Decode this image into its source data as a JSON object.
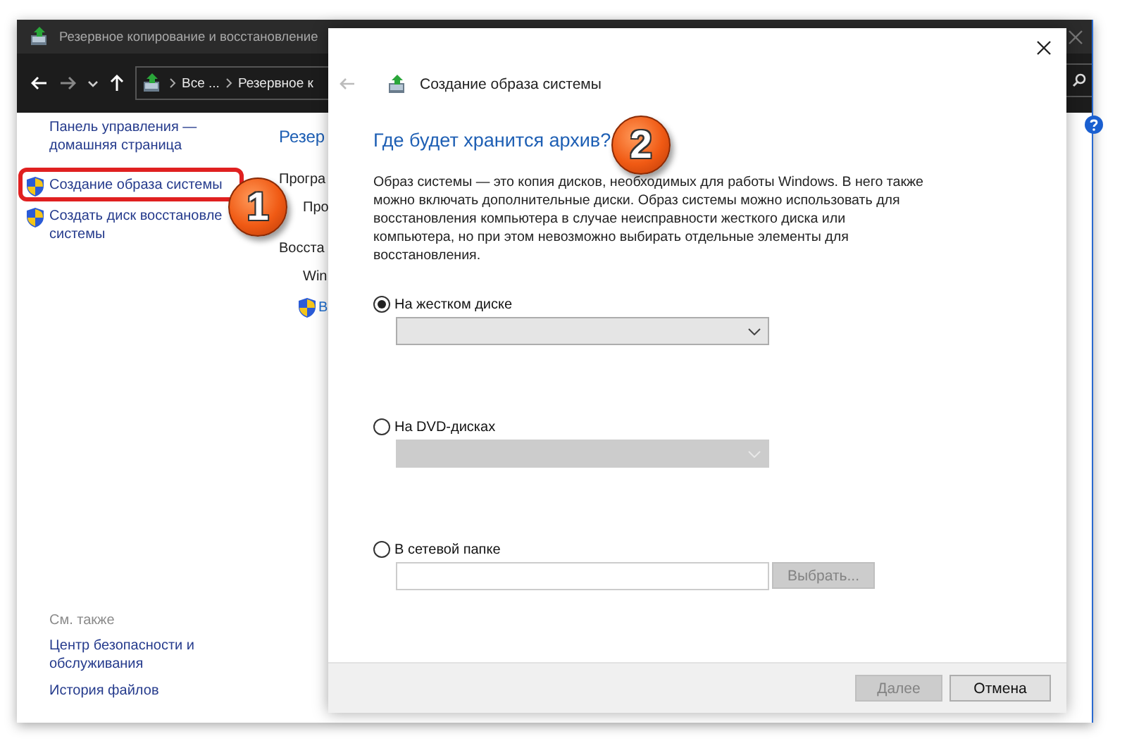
{
  "window": {
    "title": "Резервное копирование и восстановление",
    "address": [
      "Все ...",
      "Резервное к"
    ]
  },
  "sidebar": {
    "links": [
      {
        "lines": [
          "Панель управления —",
          "домашняя страница"
        ],
        "kind": "plain"
      },
      {
        "lines": [
          "Создание образа системы"
        ],
        "kind": "shield"
      },
      {
        "lines": [
          "Создать диск восстановле",
          "системы"
        ],
        "kind": "shield"
      }
    ],
    "see_also": {
      "heading": "См. также",
      "links": [
        {
          "lines": [
            "Центр безопасности и",
            "обслуживания"
          ]
        },
        {
          "lines": [
            "История файлов"
          ]
        }
      ]
    }
  },
  "main": {
    "heading": "Резер",
    "items": [
      {
        "text": "Програ",
        "kind": "section"
      },
      {
        "text": "Про",
        "kind": "indent"
      },
      {
        "text": "Восста",
        "kind": "section"
      },
      {
        "text": "Win",
        "kind": "indent"
      },
      {
        "text": "В",
        "kind": "shield-link"
      }
    ]
  },
  "dialog": {
    "title": "Создание образа системы",
    "heading": "Где будет хранится архив?",
    "description": "Образ системы — это копия дисков, необходимых для работы Windows. В него также можно включать дополнительные диски. Образ системы можно использовать для восстановления компьютера в случае неисправности жесткого диска или компьютера, но при этом невозможно выбирать отдельные элементы для восстановления.",
    "options": [
      {
        "label": "На жестком диске",
        "selected": true,
        "kind": "dropdown",
        "disabled": false
      },
      {
        "label": "На DVD-дисках",
        "selected": false,
        "kind": "dropdown",
        "disabled": true
      },
      {
        "label": "В сетевой папке",
        "selected": false,
        "kind": "folder",
        "browse": {
          "label": "Выбрать...",
          "disabled": true
        }
      }
    ],
    "buttons": [
      {
        "label": "Далее",
        "disabled": true
      },
      {
        "label": "Отмена",
        "disabled": false
      }
    ]
  },
  "annotations": [
    {
      "label": "1"
    },
    {
      "label": "2"
    }
  ]
}
